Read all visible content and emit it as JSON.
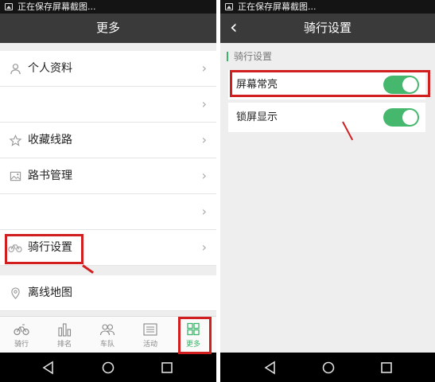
{
  "left": {
    "status_text": "正在保存屏幕截图...",
    "title": "更多",
    "menu": [
      {
        "label": "个人资料",
        "icon": "person-icon"
      },
      {
        "label": "",
        "icon": ""
      },
      {
        "label": "收藏线路",
        "icon": "star-icon"
      },
      {
        "label": "路书管理",
        "icon": "map-image-icon"
      },
      {
        "label": "",
        "icon": ""
      },
      {
        "label": "骑行设置",
        "icon": "bicycle-icon"
      },
      {
        "label": "离线地图",
        "icon": "location-pin-icon"
      }
    ],
    "tabs": [
      {
        "label": "骑行",
        "icon": "bicycle-icon"
      },
      {
        "label": "排名",
        "icon": "bar-chart-icon"
      },
      {
        "label": "车队",
        "icon": "group-icon"
      },
      {
        "label": "活动",
        "icon": "list-icon"
      },
      {
        "label": "更多",
        "icon": "grid-icon",
        "active": true
      }
    ]
  },
  "right": {
    "status_text": "正在保存屏幕截图...",
    "title": "骑行设置",
    "section_title": "骑行设置",
    "settings": [
      {
        "label": "屏幕常亮",
        "enabled": true
      },
      {
        "label": "锁屏显示",
        "enabled": true
      }
    ]
  },
  "colors": {
    "accent": "#3bb56b",
    "highlight": "#d11f1f",
    "titlebar": "#3a3a3a"
  }
}
